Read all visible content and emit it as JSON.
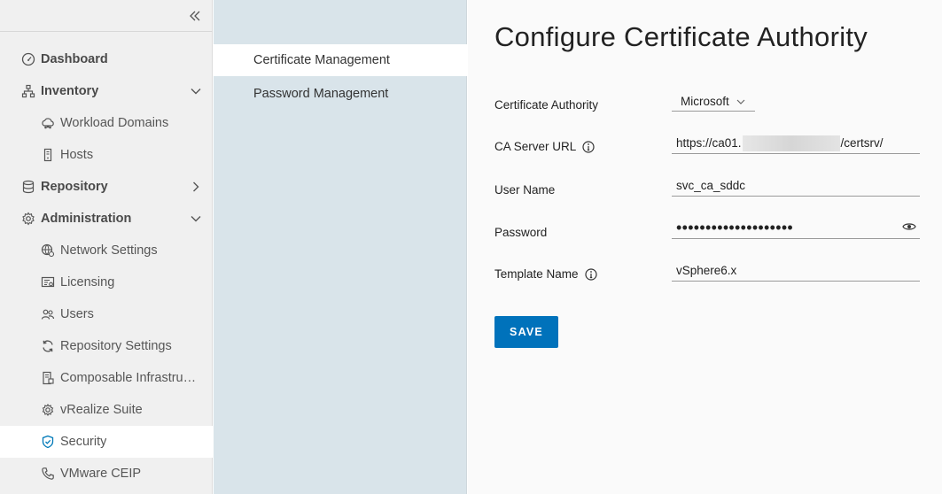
{
  "nav": {
    "collapse_icon": "double-chevron-left-icon",
    "items": [
      {
        "label": "Dashboard",
        "icon": "gauge-icon",
        "kind": "group"
      },
      {
        "label": "Inventory",
        "icon": "hierarchy-icon",
        "kind": "group",
        "expanded": true
      },
      {
        "label": "Workload Domains",
        "icon": "cloud-cluster-icon",
        "kind": "sub"
      },
      {
        "label": "Hosts",
        "icon": "host-icon",
        "kind": "sub"
      },
      {
        "label": "Repository",
        "icon": "database-icon",
        "kind": "group",
        "expanded": false
      },
      {
        "label": "Administration",
        "icon": "gear-icon",
        "kind": "group",
        "expanded": true
      },
      {
        "label": "Network Settings",
        "icon": "network-globe-icon",
        "kind": "sub"
      },
      {
        "label": "Licensing",
        "icon": "license-icon",
        "kind": "sub"
      },
      {
        "label": "Users",
        "icon": "users-icon",
        "kind": "sub"
      },
      {
        "label": "Repository Settings",
        "icon": "sync-icon",
        "kind": "sub"
      },
      {
        "label": "Composable Infrastructure",
        "icon": "composable-icon",
        "kind": "sub"
      },
      {
        "label": "vRealize Suite",
        "icon": "gear-small-icon",
        "kind": "sub"
      },
      {
        "label": "Security",
        "icon": "shield-icon",
        "kind": "sub",
        "active": true
      },
      {
        "label": "VMware CEIP",
        "icon": "phone-icon",
        "kind": "sub"
      }
    ]
  },
  "subnav": {
    "items": [
      {
        "label": "Certificate Management",
        "active": true
      },
      {
        "label": "Password Management",
        "active": false
      }
    ]
  },
  "main": {
    "title": "Configure Certificate Authority",
    "fields": {
      "ca_label": "Certificate Authority",
      "ca_value": "Microsoft",
      "url_label": "CA Server URL",
      "url_prefix": "https://ca01.",
      "url_suffix": "/certsrv/",
      "user_label": "User Name",
      "user_value": "svc_ca_sddc",
      "password_label": "Password",
      "password_value": "••••••••••••••••••••",
      "template_label": "Template Name",
      "template_value": "vSphere6.x"
    },
    "save_label": "SAVE"
  },
  "colors": {
    "accent": "#0072bb",
    "nav_bg": "#f0f0f0",
    "subnav_bg": "#d9e4ea",
    "security_icon": "#0079b8"
  }
}
